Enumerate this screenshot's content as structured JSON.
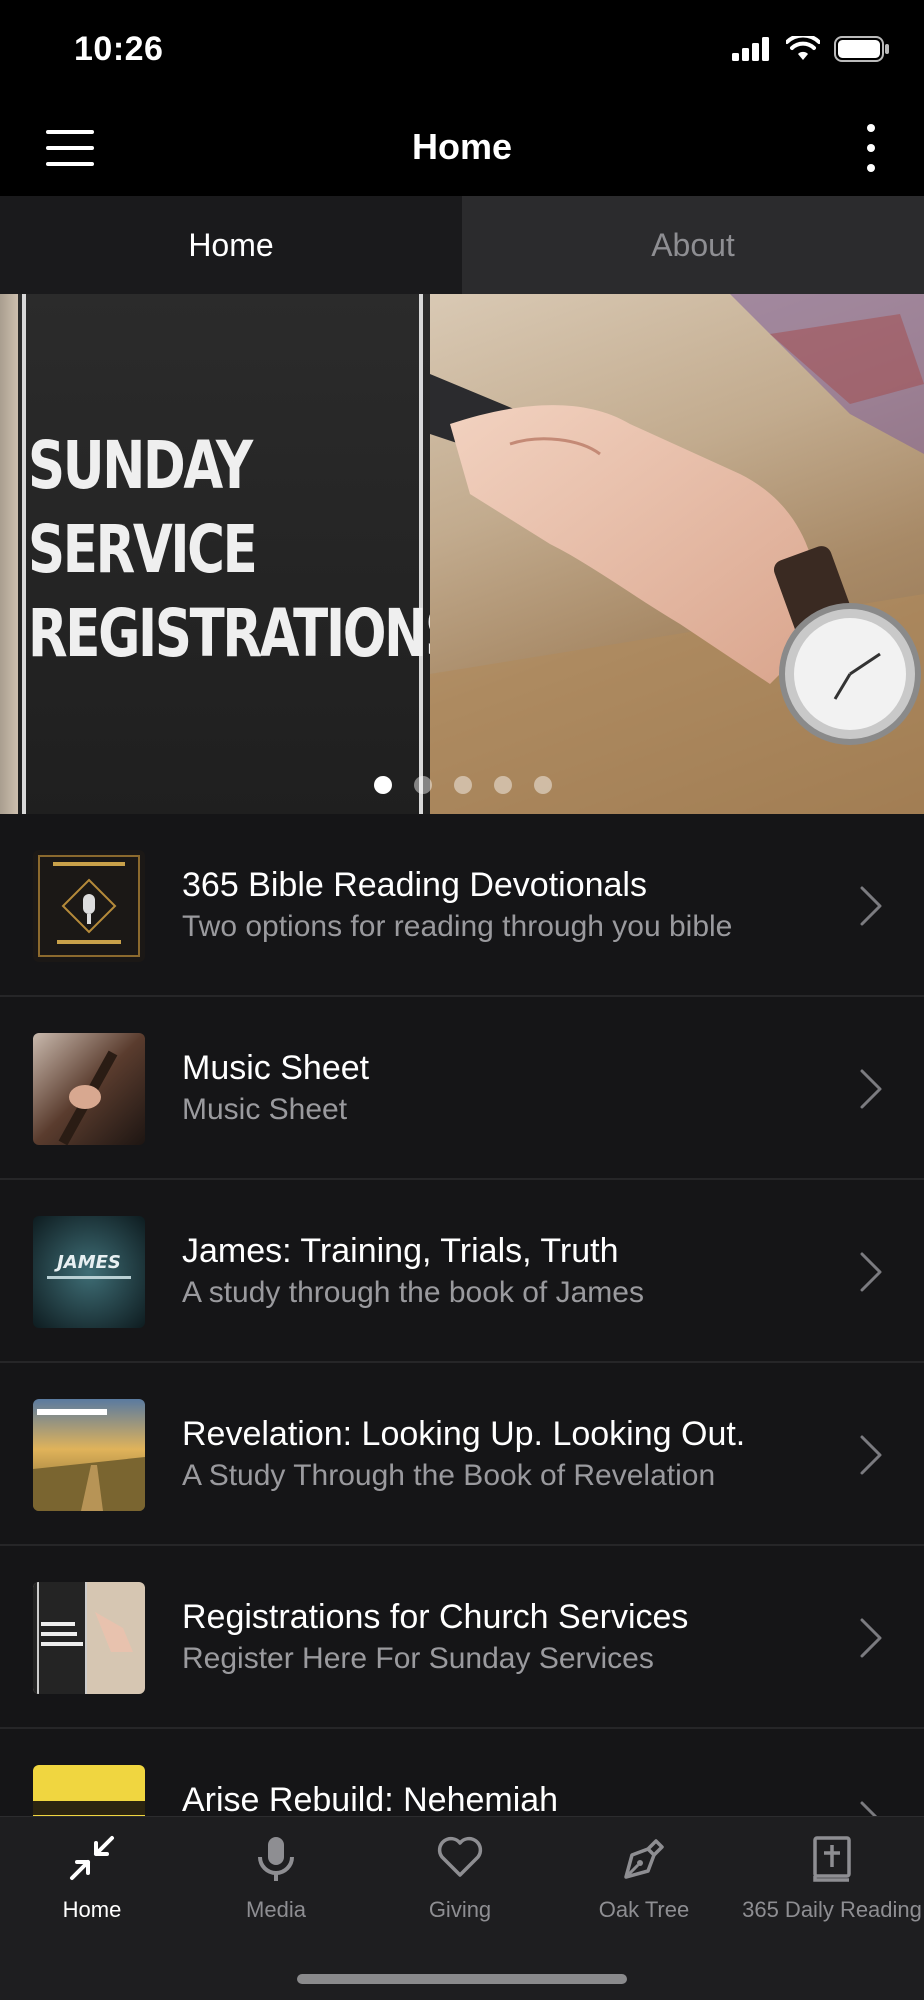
{
  "status_bar": {
    "time": "10:26"
  },
  "nav": {
    "title": "Home"
  },
  "tabs": [
    {
      "label": "Home",
      "active": true
    },
    {
      "label": "About",
      "active": false
    }
  ],
  "banner": {
    "lines": [
      "SUNDAY",
      "SERVICE",
      "REGISTRATIONS"
    ],
    "slide_count": 5,
    "active_slide": 1
  },
  "list": [
    {
      "title": "365 Bible Reading Devotionals",
      "subtitle": "Two options for reading through you bible"
    },
    {
      "title": "Music Sheet",
      "subtitle": "Music Sheet"
    },
    {
      "title": "James: Training, Trials, Truth",
      "subtitle": "A study through the book of James"
    },
    {
      "title": "Revelation: Looking Up. Looking Out.",
      "subtitle": "A Study Through the Book of Revelation"
    },
    {
      "title": "Registrations for Church Services",
      "subtitle": "Register Here For Sunday Services"
    },
    {
      "title": "Arise Rebuild: Nehemiah",
      "subtitle": ""
    }
  ],
  "tab_bar": [
    {
      "label": "Home",
      "icon": "compress-arrows-icon",
      "active": true
    },
    {
      "label": "Media",
      "icon": "microphone-icon",
      "active": false
    },
    {
      "label": "Giving",
      "icon": "heart-icon",
      "active": false
    },
    {
      "label": "Oak Tree",
      "icon": "pen-nib-icon",
      "active": false
    },
    {
      "label": "365 Daily Reading",
      "icon": "bible-book-icon",
      "active": false
    }
  ],
  "colors": {
    "background": "#141416",
    "header": "#000000",
    "tab_active": "#1a1a1c",
    "tab_inactive": "#2b2b2d",
    "subtitle": "#9a9a9e",
    "tab_bar": "#1e1e20"
  }
}
